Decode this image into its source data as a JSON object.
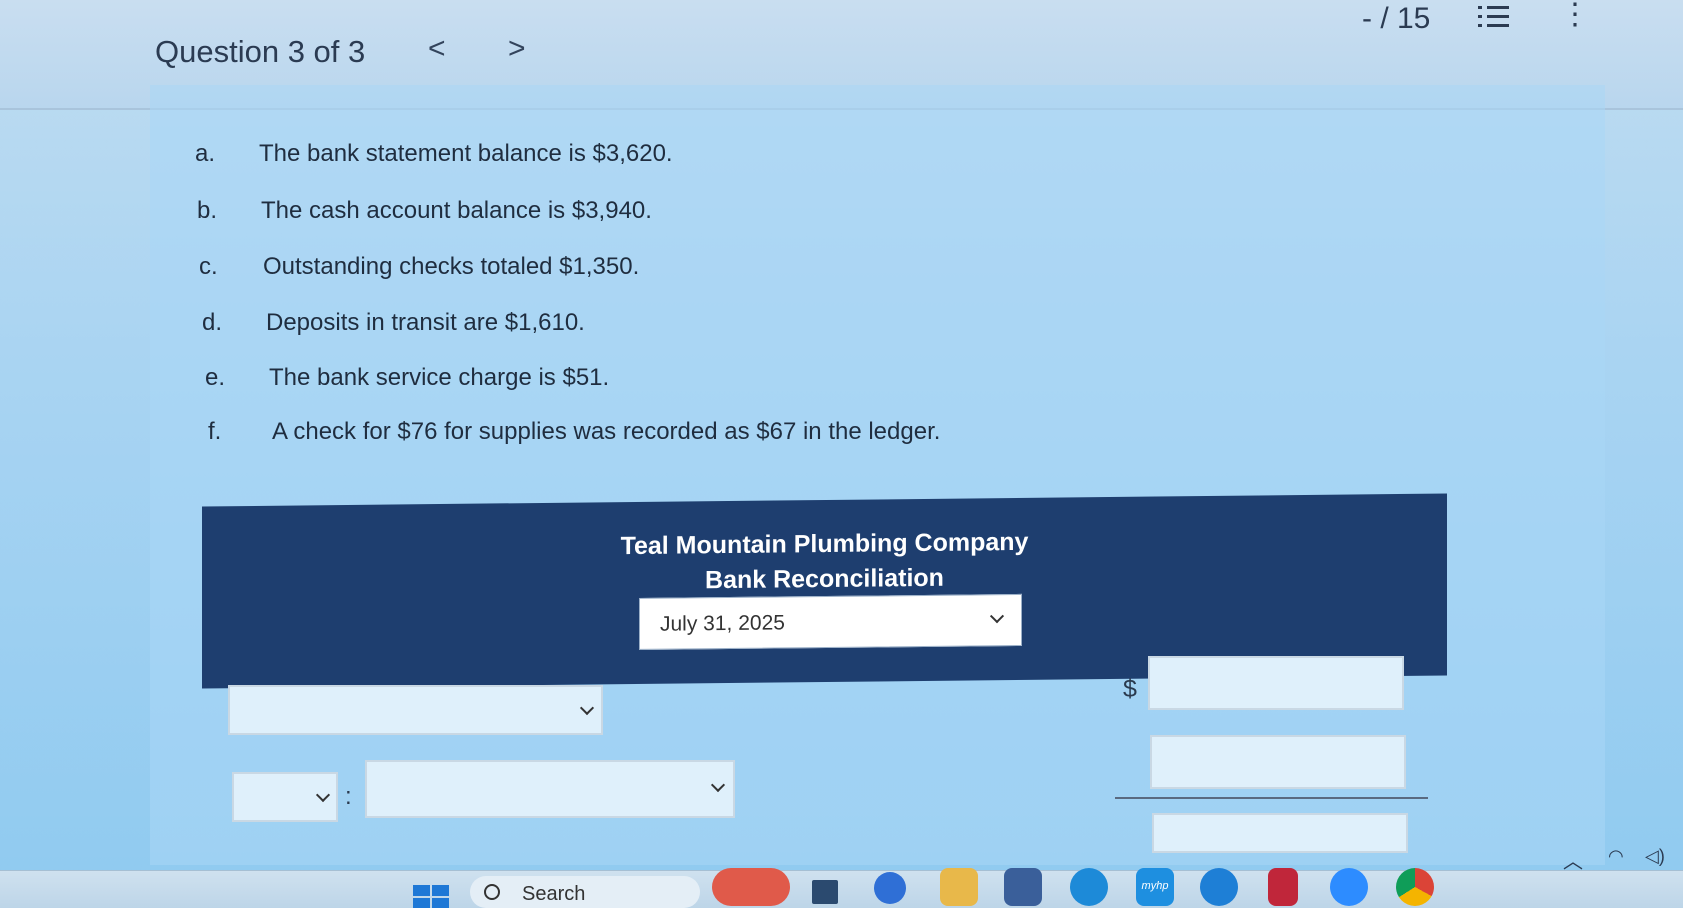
{
  "header": {
    "question_label": "Question 3 of 3",
    "prev_glyph": "<",
    "next_glyph": ">",
    "score": "- / 15",
    "list_icon": "list-icon",
    "more_icon": "more-vertical-icon",
    "more_glyph": "⋮"
  },
  "items": [
    {
      "label": "a.",
      "text": "The bank statement balance is $3,620."
    },
    {
      "label": "b.",
      "text": "The cash account balance is $3,940."
    },
    {
      "label": "c.",
      "text": "Outstanding checks totaled $1,350."
    },
    {
      "label": "d.",
      "text": "Deposits in transit are $1,610."
    },
    {
      "label": "e.",
      "text": "The bank service charge is $51."
    },
    {
      "label": "f.",
      "text": "A check for $76 for supplies was recorded as $67 in the ledger."
    }
  ],
  "reconciliation": {
    "company": "Teal Mountain Plumbing Company",
    "title": "Bank Reconciliation",
    "date_selected": "July 31, 2025",
    "dollar_sign": "$",
    "colon": ":",
    "header_color": "#1e3e6f"
  },
  "taskbar": {
    "search_placeholder": "Search",
    "apps": [
      "windows-start-icon",
      "widgets-icon",
      "task-view-icon",
      "meet-icon",
      "file-explorer-icon",
      "microsoft-store-icon",
      "edge-icon",
      "myhp-icon",
      "help-icon",
      "mcafee-icon",
      "zoom-icon",
      "chrome-icon"
    ],
    "myhp_label": "myhp"
  }
}
